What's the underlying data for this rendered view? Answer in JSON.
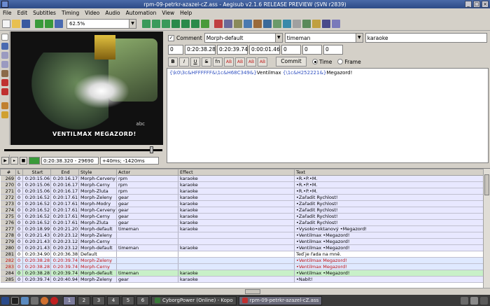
{
  "window": {
    "title": "rpm-09-petrkr-azazel-cZ.ass - Aegisub v2.1.6 RELEASE PREVIEW (SVN r2839)",
    "buttons": [
      "_",
      "□",
      "×"
    ]
  },
  "menu": [
    "File",
    "Edit",
    "Subtitles",
    "Timing",
    "Video",
    "Audio",
    "Automation",
    "View",
    "Help"
  ],
  "toolbar": {
    "zoom": "62.5%"
  },
  "video": {
    "subtitle": "VENTILMAX MEGAZORD!",
    "channel_logo": "abc",
    "time": "0:20:38.320 - 29690",
    "offset": "+40ms; -1420ms",
    "seek_position": 0.93
  },
  "editbox": {
    "comment_label": "Comment",
    "style": "Morph-default",
    "actor": "timeman",
    "effect": "karaoke",
    "layer": "0",
    "start": "0:20:38.28",
    "end": "0:20:39.74",
    "duration": "0:00:01.46",
    "margin_l": "0",
    "margin_r": "0",
    "margin_v": "0",
    "format_buttons": [
      "B",
      "I",
      "U",
      "S",
      "fn",
      "AB",
      "AB",
      "AB",
      "AB"
    ],
    "commit_label": "Commit",
    "time_label": "Time",
    "frame_label": "Frame",
    "text_tag1": "{\\k0\\3c&HFFFFFF&\\1c&H68C349&}",
    "text_word1": "Ventilmax ",
    "text_tag2": "{\\1c&H252221&}",
    "text_word2": "Megazord!"
  },
  "grid": {
    "headers": [
      "#",
      "L",
      "Start",
      "End",
      "Style",
      "Actor",
      "Effect",
      "Text"
    ],
    "rows": [
      {
        "n": "269",
        "l": "0",
        "start": "0:20:15.06",
        "end": "0:20:16.17",
        "style": "Morph-Cerveny",
        "actor": "rpm",
        "effect": "karaoke",
        "text": "•R.•P.•M.",
        "kind": "dlg"
      },
      {
        "n": "270",
        "l": "0",
        "start": "0:20:15.06",
        "end": "0:20:16.17",
        "style": "Morph-Cerny",
        "actor": "rpm",
        "effect": "karaoke",
        "text": "•R.•P.•M.",
        "kind": "dlg"
      },
      {
        "n": "271",
        "l": "0",
        "start": "0:20:15.06",
        "end": "0:20:16.17",
        "style": "Morph-Zluta",
        "actor": "rpm",
        "effect": "karaoke",
        "text": "•R.•P.•M.",
        "kind": "dlg"
      },
      {
        "n": "272",
        "l": "0",
        "start": "0:20:16.52",
        "end": "0:20:17.61",
        "style": "Morph-Zeleny",
        "actor": "gear",
        "effect": "karaoke",
        "text": "•Zařadit Rychlost!",
        "kind": "dlg"
      },
      {
        "n": "273",
        "l": "0",
        "start": "0:20:16.52",
        "end": "0:20:17.61",
        "style": "Morph-Modry",
        "actor": "gear",
        "effect": "karaoke",
        "text": "•Zařadit Rychlost!",
        "kind": "dlg"
      },
      {
        "n": "274",
        "l": "0",
        "start": "0:20:16.52",
        "end": "0:20:17.61",
        "style": "Morph-Cerveny",
        "actor": "gear",
        "effect": "karaoke",
        "text": "•Zařadit Rychlost!",
        "kind": "dlg"
      },
      {
        "n": "275",
        "l": "0",
        "start": "0:20:16.52",
        "end": "0:20:17.61",
        "style": "Morph-Cerny",
        "actor": "gear",
        "effect": "karaoke",
        "text": "•Zařadit Rychlost!",
        "kind": "dlg"
      },
      {
        "n": "276",
        "l": "0",
        "start": "0:20:16.52",
        "end": "0:20:17.61",
        "style": "Morph-Zluta",
        "actor": "gear",
        "effect": "karaoke",
        "text": "•Zařadit Rychlost!",
        "kind": "dlg"
      },
      {
        "n": "277",
        "l": "0",
        "start": "0:20:18.99",
        "end": "0:20:21.20",
        "style": "Morph-default",
        "actor": "timeman",
        "effect": "karaoke",
        "text": "•Vysoko•oktanový •Megazord!",
        "kind": "dlg"
      },
      {
        "n": "278",
        "l": "0",
        "start": "0:20:21.43",
        "end": "0:20:23.12",
        "style": "Morph-Zeleny",
        "actor": "",
        "effect": "",
        "text": "•Ventilmax •Megazord!",
        "kind": "dlg"
      },
      {
        "n": "279",
        "l": "0",
        "start": "0:20:21.43",
        "end": "0:20:23.12",
        "style": "Morph-Cerny",
        "actor": "",
        "effect": "",
        "text": "•Ventilmax •Megazord!",
        "kind": "dlg"
      },
      {
        "n": "280",
        "l": "0",
        "start": "0:20:21.43",
        "end": "0:20:23.12",
        "style": "Morph-default",
        "actor": "timeman",
        "effect": "karaoke",
        "text": "•Ventilmax •Megazord!",
        "kind": "dlg"
      },
      {
        "n": "281",
        "l": "0",
        "start": "0:20:34.90",
        "end": "0:20:36.38",
        "style": "Default",
        "actor": "",
        "effect": "",
        "text": "Teď je řada na mně.",
        "kind": "plain"
      },
      {
        "n": "282",
        "l": "0",
        "start": "0:20:38.28",
        "end": "0:20:39.74",
        "style": "Morph-Zeleny",
        "actor": "",
        "effect": "",
        "text": "•Ventilmax Megazord!",
        "kind": "sel"
      },
      {
        "n": "283",
        "l": "0",
        "start": "0:20:38.28",
        "end": "0:20:39.74",
        "style": "Morph-Cerny",
        "actor": "",
        "effect": "",
        "text": "•Ventilmax Megazord!",
        "kind": "sel"
      },
      {
        "n": "284",
        "l": "0",
        "start": "0:20:38.28",
        "end": "0:20:39.74",
        "style": "Morph-default",
        "actor": "timeman",
        "effect": "karaoke",
        "text": "•Ventilmax •Megazord!",
        "kind": "cur"
      },
      {
        "n": "285",
        "l": "0",
        "start": "0:20:39.74",
        "end": "0:20:40.94",
        "style": "Morph-Zeleny",
        "actor": "gear",
        "effect": "karaoke",
        "text": "•Nabít!",
        "kind": "dlg"
      }
    ]
  },
  "taskbar": {
    "desktops": [
      "1",
      "2",
      "3",
      "4",
      "5",
      "6"
    ],
    "tasks": [
      "CyborgPower (Online) - Kopo",
      "rpm-09-petrkr-azazel-cZ.ass"
    ]
  },
  "colors": {
    "titlebar": "#2c4a86",
    "selected_text": "#c01010",
    "current_row": "#c8f0c8",
    "dialogue_row": "#e8e8ff"
  }
}
